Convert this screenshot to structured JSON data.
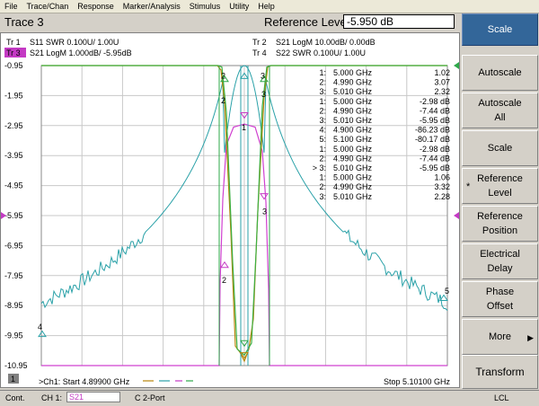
{
  "menu": [
    "File",
    "Trace/Chan",
    "Response",
    "Marker/Analysis",
    "Stimulus",
    "Utility",
    "Help"
  ],
  "toolbar": {
    "trace_title": "Trace 3",
    "ref_level_label": "Reference Level",
    "ref_level_value": "-5.950 dB"
  },
  "sidebar": {
    "header": "Scale",
    "buttons": [
      {
        "label": "Autoscale"
      },
      {
        "label": "Autoscale\nAll"
      },
      {
        "label": "Scale"
      },
      {
        "label": "Reference\nLevel",
        "marker": "*"
      },
      {
        "label": "Reference\nPosition"
      },
      {
        "label": "Electrical\nDelay"
      },
      {
        "label": "Phase\nOffset"
      },
      {
        "label": "More",
        "arrow": "▶"
      },
      {
        "label": "Transform"
      }
    ]
  },
  "traces_legend": [
    {
      "tr": "Tr 1",
      "text": "S11 SWR 0.100U/  1.00U",
      "color": "#b8860b"
    },
    {
      "tr": "Tr 2",
      "text": "S21 LogM 10.00dB/  0.00dB",
      "color": "#008b8b"
    },
    {
      "tr": "Tr 3",
      "text": "S21 LogM 1.000dB/  -5.95dB",
      "color": "#c43ac4",
      "active": true
    },
    {
      "tr": "Tr 4",
      "text": "S22 SWR 0.100U/  1.00U",
      "color": "#2ea84a"
    }
  ],
  "y_ticks": [
    "-0.95",
    "-1.95",
    "-2.95",
    "-3.95",
    "-4.95",
    "-5.95",
    "-6.95",
    "-7.95",
    "-8.95",
    "-9.95",
    "-10.95"
  ],
  "marker_table": [
    {
      "id": "1:",
      "freq": "5.000 GHz",
      "val": "1.02",
      "color": "#b8860b"
    },
    {
      "id": "2:",
      "freq": "4.990 GHz",
      "val": "3.07",
      "color": "#b8860b"
    },
    {
      "id": "3:",
      "freq": "5.010 GHz",
      "val": "2.32",
      "color": "#b8860b"
    },
    {
      "id": "1:",
      "freq": "5.000 GHz",
      "val": "-2.98 dB",
      "color": "#008b8b"
    },
    {
      "id": "2:",
      "freq": "4.990 GHz",
      "val": "-7.44 dB",
      "color": "#008b8b"
    },
    {
      "id": "3:",
      "freq": "5.010 GHz",
      "val": "-5.95 dB",
      "color": "#008b8b"
    },
    {
      "id": "4:",
      "freq": "4.900 GHz",
      "val": "-86.23 dB",
      "color": "#008b8b"
    },
    {
      "id": "5:",
      "freq": "5.100 GHz",
      "val": "-80.17 dB",
      "color": "#008b8b"
    },
    {
      "id": "1:",
      "freq": "5.000 GHz",
      "val": "-2.98 dB",
      "color": "#c43ac4"
    },
    {
      "id": "2:",
      "freq": "4.990 GHz",
      "val": "-7.44 dB",
      "color": "#c43ac4"
    },
    {
      "id": "> 3:",
      "freq": "5.010 GHz",
      "val": "-5.95 dB",
      "color": "#c43ac4"
    },
    {
      "id": "1:",
      "freq": "5.000 GHz",
      "val": "1.06",
      "color": "#2ea84a"
    },
    {
      "id": "2:",
      "freq": "4.990 GHz",
      "val": "3.32",
      "color": "#2ea84a"
    },
    {
      "id": "3:",
      "freq": "5.010 GHz",
      "val": "2.28",
      "color": "#2ea84a"
    }
  ],
  "bottom": {
    "channel_badge": "1",
    "start": ">Ch1: Start  4.89900 GHz",
    "stop": "Stop  5.10100 GHz"
  },
  "status": {
    "cont": "Cont.",
    "ch": "CH 1:",
    "param": "S21",
    "port": "C 2-Port",
    "lcl": "LCL"
  },
  "chart_data": {
    "type": "line",
    "x_range_ghz": [
      4.899,
      5.101
    ],
    "ylim": [
      -10.95,
      -0.95
    ],
    "series": [
      {
        "name": "S11 SWR",
        "color": "#b8860b"
      },
      {
        "name": "S21 LogM 10.00dB/",
        "color": "#008b8b"
      },
      {
        "name": "S21 LogM 1.000dB/",
        "color": "#c43ac4"
      },
      {
        "name": "S22 SWR",
        "color": "#2ea84a"
      }
    ]
  }
}
